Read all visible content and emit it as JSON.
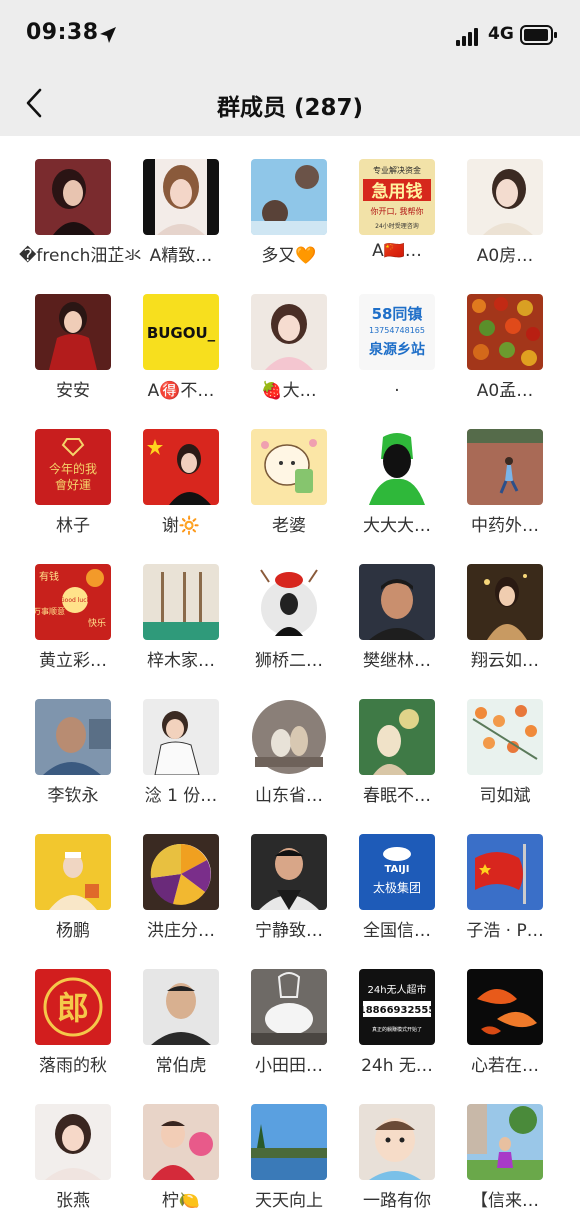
{
  "status": {
    "time": "09:38",
    "network": "4G"
  },
  "header": {
    "title": "群成员 (287)"
  },
  "members": [
    {
      "name": "�french沺芷氺"
    },
    {
      "name": "A精致…"
    },
    {
      "name": "多又🧡"
    },
    {
      "name": "A🇨🇳…"
    },
    {
      "name": "A0房…"
    },
    {
      "name": "安安"
    },
    {
      "name": "A🉐不…"
    },
    {
      "name": "🍓大…"
    },
    {
      "name": "."
    },
    {
      "name": "A0孟…"
    },
    {
      "name": "林子"
    },
    {
      "name": "谢🔆"
    },
    {
      "name": "老婆"
    },
    {
      "name": "大大大…"
    },
    {
      "name": "中药外…"
    },
    {
      "name": "黄立彩…"
    },
    {
      "name": "梓木家…"
    },
    {
      "name": "狮桥二…"
    },
    {
      "name": "樊继林…"
    },
    {
      "name": "翔云如…"
    },
    {
      "name": "李钦永"
    },
    {
      "name": "淰 1 份…"
    },
    {
      "name": "山东省…"
    },
    {
      "name": "春眠不…"
    },
    {
      "name": "司如斌"
    },
    {
      "name": "杨鹏"
    },
    {
      "name": "洪庄分…"
    },
    {
      "name": "宁静致…"
    },
    {
      "name": "全国信…"
    },
    {
      "name": "子浩 · P…"
    },
    {
      "name": "落雨的秋"
    },
    {
      "name": "常伯虎"
    },
    {
      "name": "小田田…"
    },
    {
      "name": "24h 无…"
    },
    {
      "name": "心若在…"
    },
    {
      "name": "张燕"
    },
    {
      "name": "柠🍋"
    },
    {
      "name": "天天向上"
    },
    {
      "name": "一路有你"
    },
    {
      "name": "【信来…"
    }
  ],
  "avatar_text": {
    "a4_line1": "专业解决资金",
    "a4_big": "急用钱",
    "a4_line2": "你开口, 我帮你",
    "a4_line3": "24小时受理咨询",
    "a7": "BUGOU_",
    "a9_brand": "58同镇",
    "a9_phone": "13754748165",
    "a9_sub": "泉源乡站",
    "a11_line1": "今年的我",
    "a11_line2": "會好運",
    "a16_top": "有钱",
    "a16_good": "Good luck",
    "a16_left": "万事顺意",
    "a16_right": "快乐",
    "a29_brand": "TAIJI",
    "a29_name": "太极集团",
    "a31": "郎",
    "a34_title": "24h无人超市",
    "a34_phone": "18866932555",
    "a34_sub": "真正的躺赚模式开始了"
  }
}
